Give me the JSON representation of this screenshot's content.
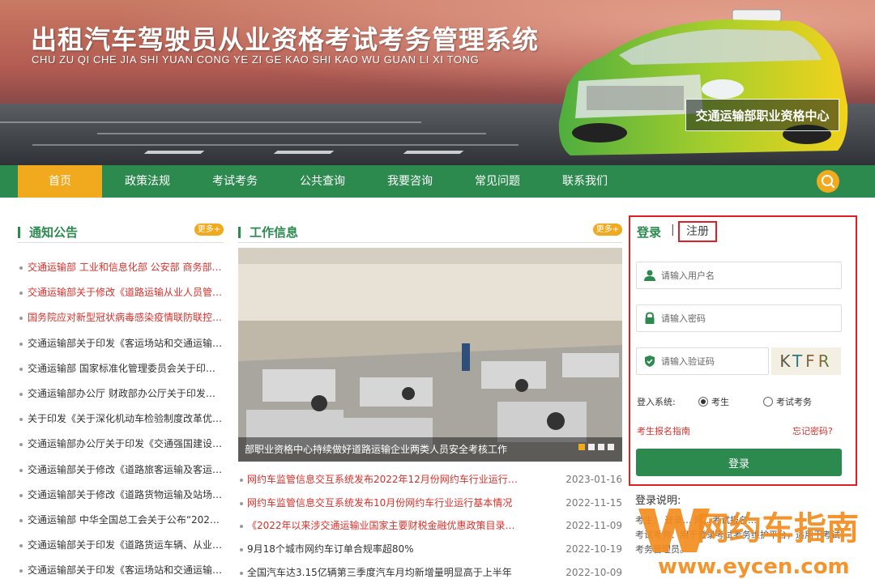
{
  "header": {
    "title_cn": "出租汽车驾驶员从业资格考试考务管理系统",
    "title_en": "CHU ZU QI CHE JIA SHI YUAN CONG YE ZI GE KAO SHI KAO WU GUAN LI XI TONG",
    "center_name": "交通运输部职业资格中心"
  },
  "nav": {
    "items": [
      "首页",
      "政策法规",
      "考试考务",
      "公共查询",
      "我要咨询",
      "常见问题",
      "联系我们"
    ],
    "active_index": 0
  },
  "notices": {
    "title": "通知公告",
    "more": "更多+",
    "items": [
      {
        "text": "交通运输部 工业和信息化部 公安部 商务部 …",
        "color": "red"
      },
      {
        "text": "交通运输部关于修改《道路运输从业人员管…",
        "color": "red"
      },
      {
        "text": "国务院应对新型冠状病毒感染疫情联防联控…",
        "color": "red"
      },
      {
        "text": "交通运输部关于印发《客运场站和交通运输…",
        "color": "dark"
      },
      {
        "text": "交通运输部 国家标准化管理委员会关于印发…",
        "color": "dark"
      },
      {
        "text": "交通运输部办公厅 财政部办公厅关于印发《…",
        "color": "dark"
      },
      {
        "text": "关于印发《关于深化机动车检验制度改革优…",
        "color": "dark"
      },
      {
        "text": "交通运输部办公厅关于印发《交通强国建设…",
        "color": "dark"
      },
      {
        "text": "交通运输部关于修改《道路旅客运输及客运…",
        "color": "dark"
      },
      {
        "text": "交通运输部关于修改《道路货物运输及站场…",
        "color": "dark"
      },
      {
        "text": "交通运输部 中华全国总工会关于公布“202…",
        "color": "dark"
      },
      {
        "text": "交通运输部关于印发《道路货运车辆、从业…",
        "color": "dark"
      },
      {
        "text": "交通运输部关于印发《客运场站和交通运输…",
        "color": "dark"
      }
    ]
  },
  "work": {
    "title": "工作信息",
    "more": "更多+",
    "photo_caption": "部职业资格中心持续做好道路运输企业两类人员安全考核工作",
    "items": [
      {
        "text": "网约车监管信息交互系统发布2022年12月份网约车行业运行基…",
        "date": "2023-01-16",
        "color": "red"
      },
      {
        "text": "网约车监管信息交互系统发布10月份网约车行业运行基本情况",
        "date": "2022-11-15",
        "color": "red"
      },
      {
        "text": "《2022年以来涉交通运输业国家主要财税金融优惠政策目录清…",
        "date": "2022-11-09",
        "color": "red"
      },
      {
        "text": "9月18个城市网约车订单合规率超80%",
        "date": "2022-10-19",
        "color": "dark"
      },
      {
        "text": "全国汽车达3.15亿辆第三季度汽车月均新增量明显高于上半年",
        "date": "2022-10-09",
        "color": "dark"
      }
    ]
  },
  "login": {
    "tab_login": "登录",
    "tab_separator": "|",
    "tab_register": "注册",
    "username_placeholder": "请输入用户名",
    "password_placeholder": "请输入密码",
    "captcha_placeholder": "请输入验证码",
    "captcha_text": "KTFR",
    "system_label": "登入系统:",
    "option_candidate": "考生",
    "option_exam": "考试考务",
    "selected_option": "考生",
    "guide_link": "考生报名指南",
    "forgot_link": "忘记密码?",
    "submit_label": "登录",
    "help_title": "登录说明:",
    "help_line1": "考生： 登录… 网…考试报名…",
    "help_line2": "考试考务：用于登录考试考务维护平台，适用于考试考务管理员。"
  },
  "watermark": {
    "cn": "网约车指南",
    "en": "www.eycen.com"
  },
  "colors": {
    "green": "#2c8a4f",
    "orange": "#f1a91e",
    "red": "#d9302b"
  }
}
